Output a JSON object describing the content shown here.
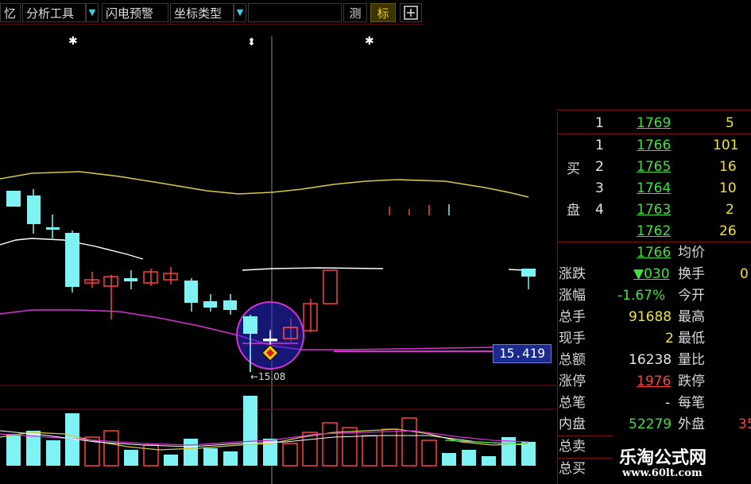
{
  "toolbar": {
    "memory_label": "忆",
    "analysis_tools_label": "分析工具",
    "flash_alert_label": "闪电预警",
    "axis_type_label": "坐标类型",
    "measure_label": "测",
    "mark_label": "标",
    "add_icon": "plus-box-icon",
    "dropdown_icon": "triangle-down-icon"
  },
  "chart": {
    "price_tag": "15.419",
    "low_marker_label": "←15.08",
    "star_icon": "diamond-marker-icon"
  },
  "order_book": {
    "top_levels": [
      {
        "side": "",
        "level": "1",
        "price": "1769",
        "volume": "5"
      }
    ],
    "buy_levels": [
      {
        "level": "1",
        "price": "1766",
        "volume": "101"
      },
      {
        "level": "2",
        "price": "1765",
        "volume": "16"
      },
      {
        "level": "3",
        "price": "1764",
        "volume": "10"
      },
      {
        "level": "4",
        "price": "1763",
        "volume": "2"
      },
      {
        "level": "",
        "price": "1762",
        "volume": "26"
      }
    ],
    "buy_side_label_1": "买",
    "buy_side_label_2": "盘"
  },
  "stats": {
    "current_price": "1766",
    "avg_price_label": "均价",
    "change_label": "涨跌",
    "change_value": "▼030",
    "turnover_label": "换手",
    "turnover_value": "0",
    "pct_label": "涨幅",
    "pct_value": "-1.67%",
    "open_label": "今开",
    "total_hands_label": "总手",
    "total_hands_value": "91688",
    "high_label": "最高",
    "current_hands_label": "现手",
    "current_hands_value": "2",
    "low_label": "最低",
    "amount_label": "总额",
    "amount_value": "16238",
    "ratio_label": "量比",
    "limit_up_label": "涨停",
    "limit_up_value": "1976",
    "limit_down_label": "跌停",
    "total_trades_label": "总笔",
    "total_trades_value": "-",
    "per_trade_label": "每笔",
    "inner_label": "内盘",
    "inner_value": "52279",
    "outer_label": "外盘",
    "outer_value": "35",
    "total_sell_label": "总卖",
    "total_buy_label": "总买"
  },
  "watermark": {
    "name": "乐淘公式网",
    "url": "www.60lt.com"
  },
  "colors": {
    "up_candle": "#ff4040",
    "down_candle": "#7ff3f3",
    "ma_yellow": "#d6c84a",
    "ma_white": "#ffffff",
    "ma_purple": "#d531d5",
    "price_tag_bg": "#1b2a8c"
  }
}
